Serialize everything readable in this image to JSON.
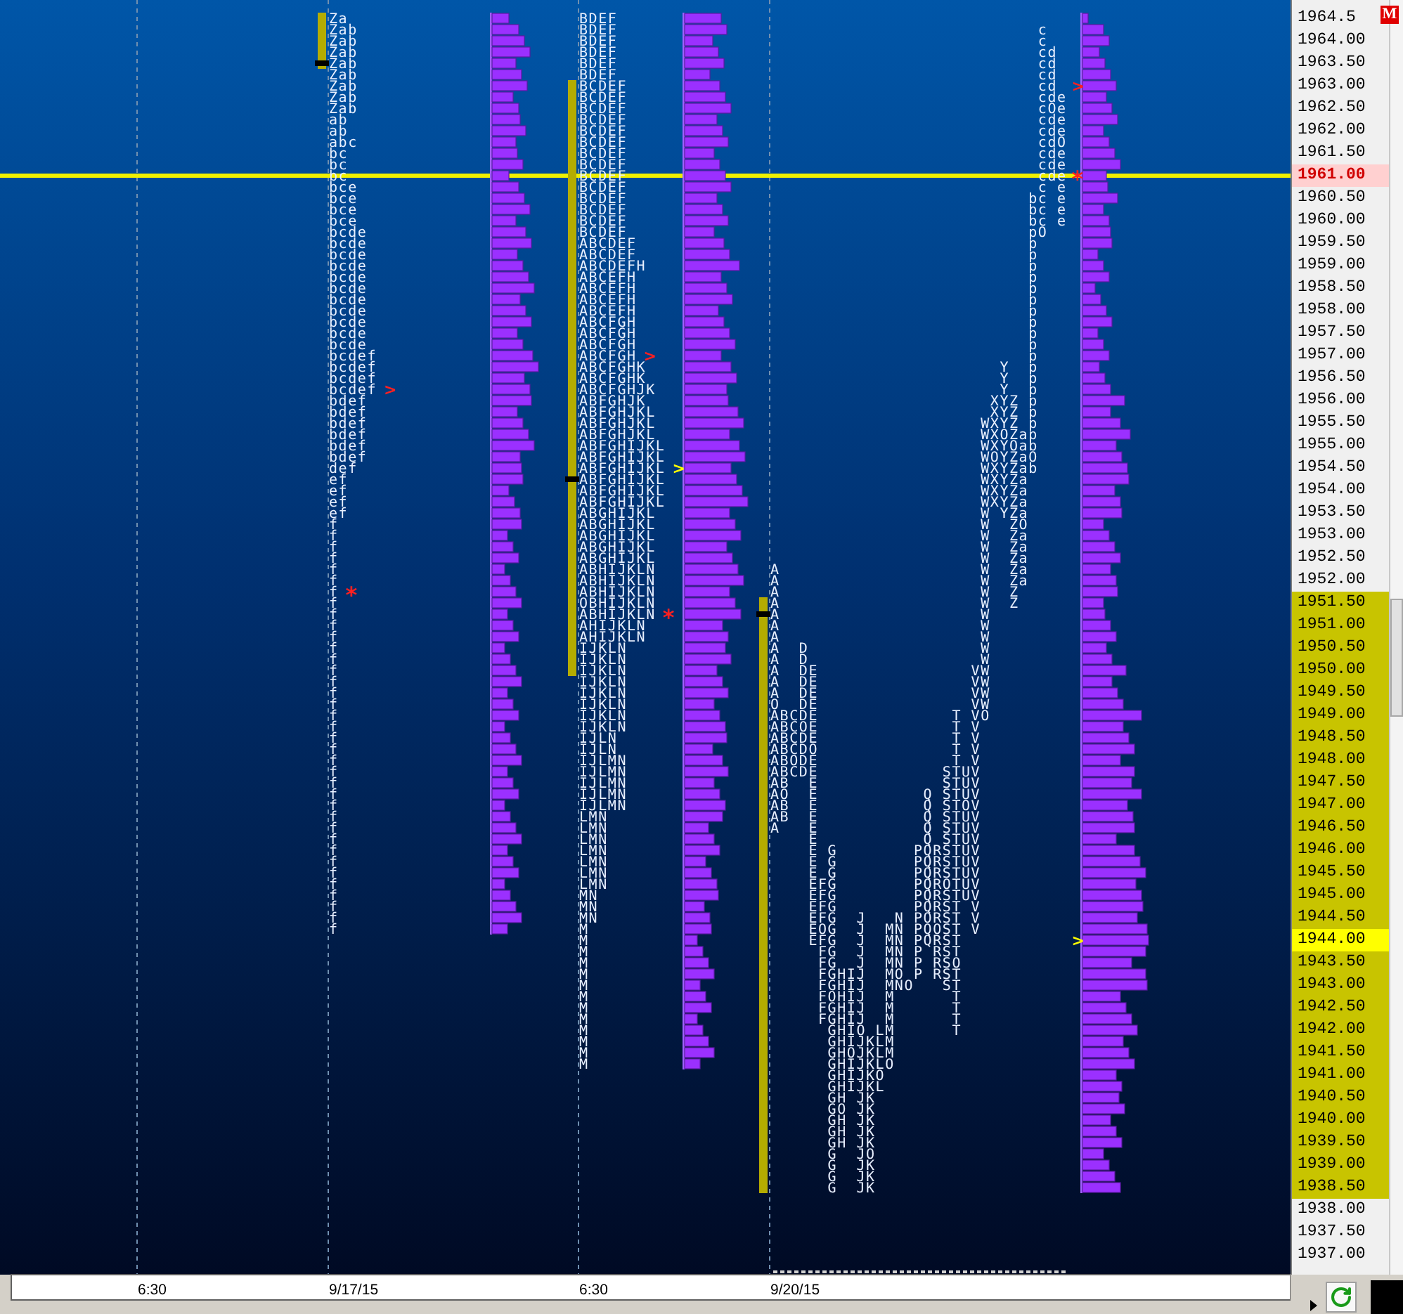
{
  "badge": "M",
  "time_labels": [
    "6:30",
    "9/17/15",
    "6:30",
    "9/20/15"
  ],
  "profiles": [
    {
      "kind": "compact",
      "rows": [
        {
          "tpo": "Za",
          "value_area": true,
          "poc": false
        },
        {
          "tpo": "Zab",
          "value_area": true,
          "poc": false
        },
        {
          "tpo": "Zab",
          "value_area": true,
          "poc": false
        },
        {
          "tpo": "Zab",
          "value_area": true,
          "poc": false
        },
        {
          "tpo": "Zab",
          "value_area": true,
          "poc": true
        },
        {
          "tpo": "Zab",
          "value_area": false,
          "poc": false
        },
        {
          "tpo": "Zab",
          "value_area": false,
          "poc": false
        },
        {
          "tpo": "Zab",
          "value_area": false,
          "poc": false
        },
        {
          "tpo": "Zab",
          "value_area": false,
          "poc": false
        },
        {
          "tpo": "ab",
          "value_area": false,
          "poc": false
        },
        {
          "tpo": "ab",
          "value_area": false,
          "poc": false
        },
        {
          "tpo": "abc",
          "value_area": false,
          "poc": false
        },
        {
          "tpo": "bc",
          "value_area": false,
          "poc": false
        },
        {
          "tpo": "bc",
          "value_area": false,
          "poc": false
        },
        {
          "tpo": "bc",
          "value_area": false,
          "poc": false
        },
        {
          "tpo": "bce",
          "value_area": false,
          "poc": false
        },
        {
          "tpo": "bce",
          "value_area": false,
          "poc": false
        },
        {
          "tpo": "bce",
          "value_area": false,
          "poc": false
        },
        {
          "tpo": "bce",
          "value_area": false,
          "poc": false
        },
        {
          "tpo": "bcde",
          "value_area": false,
          "poc": false
        },
        {
          "tpo": "bcde",
          "value_area": false,
          "poc": false
        },
        {
          "tpo": "bcde",
          "value_area": false,
          "poc": false
        },
        {
          "tpo": "bcde",
          "value_area": false,
          "poc": false
        },
        {
          "tpo": "bcde",
          "value_area": false,
          "poc": false
        },
        {
          "tpo": "bcde",
          "value_area": false,
          "poc": false
        },
        {
          "tpo": "bcde",
          "value_area": false,
          "poc": false
        },
        {
          "tpo": "bcde",
          "value_area": false,
          "poc": false
        },
        {
          "tpo": "bcde",
          "value_area": false,
          "poc": false
        },
        {
          "tpo": "bcde",
          "value_area": false,
          "poc": false
        },
        {
          "tpo": "bcde",
          "value_area": false,
          "poc": false
        },
        {
          "tpo": "bcdef",
          "value_area": false,
          "poc": false
        },
        {
          "tpo": "bcdef",
          "value_area": false,
          "poc": false
        },
        {
          "tpo": "bcdef",
          "value_area": false,
          "poc": false
        },
        {
          "tpo": "bcdef",
          "value_area": false,
          "poc": false,
          "marker": {
            "kind": "arrow",
            "text": ">",
            "color": "#ff2020"
          }
        },
        {
          "tpo": "bdef",
          "value_area": false,
          "poc": false
        },
        {
          "tpo": "bdef",
          "value_area": false,
          "poc": false
        },
        {
          "tpo": "bdef",
          "value_area": false,
          "poc": false
        },
        {
          "tpo": "bdef",
          "value_area": false,
          "poc": false
        },
        {
          "tpo": "bdef",
          "value_area": false,
          "poc": false
        },
        {
          "tpo": "bdef",
          "value_area": false,
          "poc": false
        },
        {
          "tpo": "def",
          "value_area": false,
          "poc": false
        },
        {
          "tpo": "ef",
          "value_area": false,
          "poc": false
        },
        {
          "tpo": "ef",
          "value_area": false,
          "poc": false
        },
        {
          "tpo": "ef",
          "value_area": false,
          "poc": false
        },
        {
          "tpo": "ef",
          "value_area": false,
          "poc": false
        },
        {
          "tpo": "f",
          "value_area": false,
          "poc": false
        },
        {
          "tpo": "f",
          "value_area": false,
          "poc": false
        },
        {
          "tpo": "f",
          "value_area": false,
          "poc": false
        },
        {
          "tpo": "f",
          "value_area": false,
          "poc": false
        },
        {
          "tpo": "f",
          "value_area": false,
          "poc": false
        },
        {
          "tpo": "f",
          "value_area": false,
          "poc": false
        },
        {
          "tpo": "f",
          "value_area": false,
          "poc": false,
          "marker": {
            "kind": "star",
            "text": "*",
            "color": "#ff2020"
          }
        },
        {
          "tpo": "f",
          "value_area": false,
          "poc": false
        },
        {
          "tpo": "f",
          "value_area": false,
          "poc": false
        },
        {
          "tpo": "f",
          "value_area": false,
          "poc": false
        },
        {
          "tpo": "f",
          "value_area": false,
          "poc": false
        },
        {
          "tpo": "f",
          "value_area": false,
          "poc": false
        },
        {
          "tpo": "f",
          "value_area": false,
          "poc": false
        },
        {
          "tpo": "f",
          "value_area": false,
          "poc": false
        },
        {
          "tpo": "f",
          "value_area": false,
          "poc": false
        },
        {
          "tpo": "f",
          "value_area": false,
          "poc": false
        },
        {
          "tpo": "f",
          "value_area": false,
          "poc": false
        },
        {
          "tpo": "f",
          "value_area": false,
          "poc": false
        },
        {
          "tpo": "f",
          "value_area": false,
          "poc": false
        },
        {
          "tpo": "f",
          "value_area": false,
          "poc": false
        },
        {
          "tpo": "f",
          "value_area": false,
          "poc": false
        },
        {
          "tpo": "f",
          "value_area": false,
          "poc": false
        },
        {
          "tpo": "f",
          "value_area": false,
          "poc": false
        },
        {
          "tpo": "f",
          "value_area": false,
          "poc": false
        },
        {
          "tpo": "f",
          "value_area": false,
          "poc": false
        },
        {
          "tpo": "f",
          "value_area": false,
          "poc": false
        },
        {
          "tpo": "f",
          "value_area": false,
          "poc": false
        },
        {
          "tpo": "f",
          "value_area": false,
          "poc": false
        },
        {
          "tpo": "f",
          "value_area": false,
          "poc": false
        },
        {
          "tpo": "f",
          "value_area": false,
          "poc": false
        },
        {
          "tpo": "f",
          "value_area": false,
          "poc": false
        },
        {
          "tpo": "f",
          "value_area": false,
          "poc": false
        },
        {
          "tpo": "f",
          "value_area": false,
          "poc": false
        },
        {
          "tpo": "f",
          "value_area": false,
          "poc": false
        },
        {
          "tpo": "f",
          "value_area": false,
          "poc": false
        },
        {
          "tpo": "f",
          "value_area": false,
          "poc": false
        },
        {
          "tpo": "f",
          "value_area": false,
          "poc": false
        }
      ]
    },
    {
      "kind": "compact",
      "rows": [
        {
          "tpo": "BDEF",
          "value_area": false,
          "poc": false
        },
        {
          "tpo": "BDEF",
          "value_area": false,
          "poc": false
        },
        {
          "tpo": "BDEF",
          "value_area": false,
          "poc": false
        },
        {
          "tpo": "BDEF",
          "value_area": false,
          "poc": false
        },
        {
          "tpo": "BDEF",
          "value_area": false,
          "poc": false
        },
        {
          "tpo": "BDEF",
          "value_area": false,
          "poc": false
        },
        {
          "tpo": "BCDEF",
          "value_area": true,
          "poc": false
        },
        {
          "tpo": "BCDEF",
          "value_area": true,
          "poc": false
        },
        {
          "tpo": "BCDEF",
          "value_area": true,
          "poc": false
        },
        {
          "tpo": "BCDEF",
          "value_area": true,
          "poc": false
        },
        {
          "tpo": "BCDEF",
          "value_area": true,
          "poc": false
        },
        {
          "tpo": "BCDEF",
          "value_area": true,
          "poc": false
        },
        {
          "tpo": "BCDEF",
          "value_area": true,
          "poc": false
        },
        {
          "tpo": "BCDEF",
          "value_area": true,
          "poc": false
        },
        {
          "tpo": "BCDEF",
          "value_area": true,
          "poc": false
        },
        {
          "tpo": "BCDEF",
          "value_area": true,
          "poc": false
        },
        {
          "tpo": "BCDEF",
          "value_area": true,
          "poc": false
        },
        {
          "tpo": "BCDEF",
          "value_area": true,
          "poc": false
        },
        {
          "tpo": "BCDEF",
          "value_area": true,
          "poc": false
        },
        {
          "tpo": "BCDEF",
          "value_area": true,
          "poc": false
        },
        {
          "tpo": "ABCDEF",
          "value_area": true,
          "poc": false
        },
        {
          "tpo": "ABCDEF",
          "value_area": true,
          "poc": false
        },
        {
          "tpo": "ABCDEFH",
          "value_area": true,
          "poc": false
        },
        {
          "tpo": "ABCEFH",
          "value_area": true,
          "poc": false
        },
        {
          "tpo": "ABCEFH",
          "value_area": true,
          "poc": false
        },
        {
          "tpo": "ABCEFH",
          "value_area": true,
          "poc": false
        },
        {
          "tpo": "ABCEFH",
          "value_area": true,
          "poc": false
        },
        {
          "tpo": "ABCFGH",
          "value_area": true,
          "poc": false
        },
        {
          "tpo": "ABCFGH",
          "value_area": true,
          "poc": false
        },
        {
          "tpo": "ABCFGH",
          "value_area": true,
          "poc": false
        },
        {
          "tpo": "ABCFGH",
          "value_area": true,
          "poc": false,
          "marker": {
            "kind": "arrow",
            "text": ">",
            "color": "#ff2020"
          }
        },
        {
          "tpo": "ABCFGHK",
          "value_area": true,
          "poc": false
        },
        {
          "tpo": "ABCFGHK",
          "value_area": true,
          "poc": false
        },
        {
          "tpo": "ABCFGHJK",
          "value_area": true,
          "poc": false
        },
        {
          "tpo": "ABFGHJK",
          "value_area": true,
          "poc": false
        },
        {
          "tpo": "ABFGHJKL",
          "value_area": true,
          "poc": false
        },
        {
          "tpo": "ABFGHJKL",
          "value_area": true,
          "poc": false
        },
        {
          "tpo": "ABFGHJKL",
          "value_area": true,
          "poc": false
        },
        {
          "tpo": "ABFGHIJKL",
          "value_area": true,
          "poc": false
        },
        {
          "tpo": "ABFGHIJKL",
          "value_area": true,
          "poc": false
        },
        {
          "tpo": "ABFGHIJKL",
          "value_area": true,
          "poc": false,
          "marker": {
            "kind": "arrow",
            "text": ">",
            "color": "#ffff00"
          }
        },
        {
          "tpo": "ABFGHIJKL",
          "value_area": true,
          "poc": true
        },
        {
          "tpo": "ABFGHIJKL",
          "value_area": true,
          "poc": false
        },
        {
          "tpo": "ABFGHIJKL",
          "value_area": true,
          "poc": false
        },
        {
          "tpo": "ABGHIJKL",
          "value_area": true,
          "poc": false
        },
        {
          "tpo": "ABGHIJKL",
          "value_area": true,
          "poc": false
        },
        {
          "tpo": "ABGHIJKL",
          "value_area": true,
          "poc": false
        },
        {
          "tpo": "ABGHIJKL",
          "value_area": true,
          "poc": false
        },
        {
          "tpo": "ABGHIJKL",
          "value_area": true,
          "poc": false
        },
        {
          "tpo": "ABHIJKLN",
          "value_area": true,
          "poc": false
        },
        {
          "tpo": "ABHIJKLN",
          "value_area": true,
          "poc": false
        },
        {
          "tpo": "ABHIJKLN",
          "value_area": true,
          "poc": false
        },
        {
          "tpo": "OBHIJKLN",
          "value_area": true,
          "poc": false
        },
        {
          "tpo": "ABHIJKLN",
          "value_area": true,
          "poc": false,
          "marker": {
            "kind": "star",
            "text": "*",
            "color": "#ff2020"
          }
        },
        {
          "tpo": "AHIJKLN",
          "value_area": true,
          "poc": false
        },
        {
          "tpo": "AHIJKLN",
          "value_area": true,
          "poc": false
        },
        {
          "tpo": "IJKLN",
          "value_area": true,
          "poc": false
        },
        {
          "tpo": "IJKLN",
          "value_area": true,
          "poc": false
        },
        {
          "tpo": "IJKLN",
          "value_area": true,
          "poc": false
        },
        {
          "tpo": "IJKLN",
          "value_area": false,
          "poc": false
        },
        {
          "tpo": "IJKLN",
          "value_area": false,
          "poc": false
        },
        {
          "tpo": "IJKLN",
          "value_area": false,
          "poc": false
        },
        {
          "tpo": "IJKLN",
          "value_area": false,
          "poc": false
        },
        {
          "tpo": "IJKLN",
          "value_area": false,
          "poc": false
        },
        {
          "tpo": "IJLN",
          "value_area": false,
          "poc": false
        },
        {
          "tpo": "IJLN",
          "value_area": false,
          "poc": false
        },
        {
          "tpo": "IJLMN",
          "value_area": false,
          "poc": false
        },
        {
          "tpo": "IJLMN",
          "value_area": false,
          "poc": false
        },
        {
          "tpo": "IJLMN",
          "value_area": false,
          "poc": false
        },
        {
          "tpo": "IJLMN",
          "value_area": false,
          "poc": false
        },
        {
          "tpo": "IJLMN",
          "value_area": false,
          "poc": false
        },
        {
          "tpo": "LMN",
          "value_area": false,
          "poc": false
        },
        {
          "tpo": "LMN",
          "value_area": false,
          "poc": false
        },
        {
          "tpo": "LMN",
          "value_area": false,
          "poc": false
        },
        {
          "tpo": "LMN",
          "value_area": false,
          "poc": false
        },
        {
          "tpo": "LMN",
          "value_area": false,
          "poc": false
        },
        {
          "tpo": "LMN",
          "value_area": false,
          "poc": false
        },
        {
          "tpo": "LMN",
          "value_area": false,
          "poc": false
        },
        {
          "tpo": "MN",
          "value_area": false,
          "poc": false
        },
        {
          "tpo": "MN",
          "value_area": false,
          "poc": false
        },
        {
          "tpo": "MN",
          "value_area": false,
          "poc": false
        },
        {
          "tpo": "M",
          "value_area": false,
          "poc": false
        },
        {
          "tpo": "M",
          "value_area": false,
          "poc": false
        },
        {
          "tpo": "M",
          "value_area": false,
          "poc": false
        },
        {
          "tpo": "M",
          "value_area": false,
          "poc": false
        },
        {
          "tpo": "M",
          "value_area": false,
          "poc": false
        },
        {
          "tpo": "M",
          "value_area": false,
          "poc": false
        },
        {
          "tpo": "M",
          "value_area": false,
          "poc": false
        },
        {
          "tpo": "M",
          "value_area": false,
          "poc": false
        },
        {
          "tpo": "M",
          "value_area": false,
          "poc": false
        },
        {
          "tpo": "M",
          "value_area": false,
          "poc": false
        },
        {
          "tpo": "M",
          "value_area": false,
          "poc": false
        },
        {
          "tpo": "M",
          "value_area": false,
          "poc": false
        },
        {
          "tpo": "M",
          "value_area": false,
          "poc": false
        }
      ]
    },
    {
      "kind": "split",
      "rows": [
        {
          "value_area": false,
          "poc": false
        },
        {
          "tpo": "                            c",
          "value_area": false,
          "poc": false
        },
        {
          "tpo": "                            c",
          "value_area": false,
          "poc": false
        },
        {
          "tpo": "                            cd",
          "value_area": false,
          "poc": false
        },
        {
          "tpo": "                            cd",
          "value_area": false,
          "poc": false
        },
        {
          "tpo": "                            cd",
          "value_area": false,
          "poc": false
        },
        {
          "tpo": "                            cd",
          "value_area": false,
          "poc": false,
          "marker": {
            "kind": "arrow",
            "text": ">",
            "color": "#ff2020"
          }
        },
        {
          "tpo": "                            cde",
          "value_area": false,
          "poc": false
        },
        {
          "tpo": "                            cOe",
          "value_area": false,
          "poc": false
        },
        {
          "tpo": "                            cde",
          "value_area": false,
          "poc": false
        },
        {
          "tpo": "                            cde",
          "value_area": false,
          "poc": false
        },
        {
          "tpo": "                            cdO",
          "value_area": false,
          "poc": false
        },
        {
          "tpo": "                            cde",
          "value_area": false,
          "poc": false
        },
        {
          "tpo": "                            cde",
          "value_area": false,
          "poc": false
        },
        {
          "tpo": "                            cde",
          "value_area": false,
          "poc": false,
          "marker": {
            "kind": "star",
            "text": "*",
            "color": "#ff2020"
          }
        },
        {
          "tpo": "                            c e",
          "value_area": false,
          "poc": false
        },
        {
          "tpo": "                           bc e",
          "value_area": false,
          "poc": false
        },
        {
          "tpo": "                           bc e",
          "value_area": false,
          "poc": false
        },
        {
          "tpo": "                           bc e",
          "value_area": false,
          "poc": false
        },
        {
          "tpo": "                           pO",
          "value_area": false,
          "poc": false
        },
        {
          "tpo": "                           p",
          "value_area": false,
          "poc": false
        },
        {
          "tpo": "                           p",
          "value_area": false,
          "poc": false
        },
        {
          "tpo": "                           p",
          "value_area": false,
          "poc": false
        },
        {
          "tpo": "                           p",
          "value_area": false,
          "poc": false
        },
        {
          "tpo": "                           p",
          "value_area": false,
          "poc": false
        },
        {
          "tpo": "                           p",
          "value_area": false,
          "poc": false
        },
        {
          "tpo": "                           p",
          "value_area": false,
          "poc": false
        },
        {
          "tpo": "                           p",
          "value_area": false,
          "poc": false
        },
        {
          "tpo": "                           p",
          "value_area": false,
          "poc": false
        },
        {
          "tpo": "                           p",
          "value_area": false,
          "poc": false
        },
        {
          "tpo": "                           p",
          "value_area": false,
          "poc": false
        },
        {
          "tpo": "                        Y  p",
          "value_area": false,
          "poc": false
        },
        {
          "tpo": "                        Y  p",
          "value_area": false,
          "poc": false
        },
        {
          "tpo": "                        Y  p",
          "value_area": false,
          "poc": false
        },
        {
          "tpo": "                       XYZ p",
          "value_area": false,
          "poc": false
        },
        {
          "tpo": "                       XYZ p",
          "value_area": false,
          "poc": false
        },
        {
          "tpo": "                      WXYZ p",
          "value_area": false,
          "poc": false
        },
        {
          "tpo": "                      WXOZap",
          "value_area": false,
          "poc": false
        },
        {
          "tpo": "                      WXYOab",
          "value_area": false,
          "poc": false
        },
        {
          "tpo": "                      WOYZaO",
          "value_area": false,
          "poc": false
        },
        {
          "tpo": "                      WXYZab",
          "value_area": false,
          "poc": false
        },
        {
          "tpo": "                      WXYZa",
          "value_area": false,
          "poc": false
        },
        {
          "tpo": "                      WXYZa",
          "value_area": false,
          "poc": false
        },
        {
          "tpo": "                      WXYZa",
          "value_area": false,
          "poc": false
        },
        {
          "tpo": "                      W YZa",
          "value_area": false,
          "poc": false
        },
        {
          "tpo": "                      W  ZO",
          "value_area": false,
          "poc": false
        },
        {
          "tpo": "                      W  Za",
          "value_area": false,
          "poc": false
        },
        {
          "tpo": "                      W  Za",
          "value_area": false,
          "poc": false
        },
        {
          "tpo": "                      W  Za",
          "value_area": false,
          "poc": false
        },
        {
          "tpo": "A                     W  Za",
          "value_area": false,
          "poc": false
        },
        {
          "tpo": "A                     W  Za",
          "value_area": false,
          "poc": false
        },
        {
          "tpo": "A                     W  Z",
          "value_area": false,
          "poc": false
        },
        {
          "tpo": "A                     W  Z",
          "value_area": true,
          "poc": false
        },
        {
          "tpo": "A                     W",
          "value_area": true,
          "poc": true
        },
        {
          "tpo": "A                     W",
          "value_area": true,
          "poc": false
        },
        {
          "tpo": "A                     W",
          "value_area": true,
          "poc": false
        },
        {
          "tpo": "A  D                  W",
          "value_area": true,
          "poc": false
        },
        {
          "tpo": "A  D                  W",
          "value_area": true,
          "poc": false
        },
        {
          "tpo": "A  DE                VW",
          "value_area": true,
          "poc": false
        },
        {
          "tpo": "A  DE                VW",
          "value_area": true,
          "poc": false
        },
        {
          "tpo": "A  DE                VW",
          "value_area": true,
          "poc": false
        },
        {
          "tpo": "O  DE                VW",
          "value_area": true,
          "poc": false
        },
        {
          "tpo": "ABCDE              T VO",
          "value_area": true,
          "poc": false
        },
        {
          "tpo": "ABCOE              T V",
          "value_area": true,
          "poc": false
        },
        {
          "tpo": "ABCDE              T V",
          "value_area": true,
          "poc": false
        },
        {
          "tpo": "ABCDO              T V",
          "value_area": true,
          "poc": false
        },
        {
          "tpo": "ABODE              T V",
          "value_area": true,
          "poc": false
        },
        {
          "tpo": "ABCDE             STUV",
          "value_area": true,
          "poc": false
        },
        {
          "tpo": "AB  E             STUV",
          "value_area": true,
          "poc": false
        },
        {
          "tpo": "AO  E           Q STUV",
          "value_area": true,
          "poc": false
        },
        {
          "tpo": "AB  E           Q STOV",
          "value_area": true,
          "poc": false
        },
        {
          "tpo": "AB  E           Q STUV",
          "value_area": true,
          "poc": false
        },
        {
          "tpo": "A   E           Q STUV",
          "value_area": true,
          "poc": false
        },
        {
          "tpo": "    E           Q STUV",
          "value_area": true,
          "poc": false
        },
        {
          "tpo": "    E G        PQRSTUV",
          "value_area": true,
          "poc": false
        },
        {
          "tpo": "    E G        PQRSTUV",
          "value_area": true,
          "poc": false
        },
        {
          "tpo": "    E G        PQRSTUV",
          "value_area": true,
          "poc": false
        },
        {
          "tpo": "    EFG        PQROTUV",
          "value_area": true,
          "poc": false
        },
        {
          "tpo": "    EFG        PQRSTUV",
          "value_area": true,
          "poc": false
        },
        {
          "tpo": "    EFG        PQRST V",
          "value_area": true,
          "poc": false
        },
        {
          "tpo": "    EFG  J   N PORST V",
          "value_area": true,
          "poc": false
        },
        {
          "tpo": "    EOG  J  MN PQOST V",
          "value_area": true,
          "poc": false
        },
        {
          "tpo": "    EFG  J  MN PQRST",
          "value_area": true,
          "poc": false,
          "marker": {
            "kind": "arrow",
            "text": ">",
            "color": "#ffff00"
          }
        },
        {
          "tpo": "     FG  J  MN P RST",
          "value_area": true,
          "poc": false
        },
        {
          "tpo": "     FG  J  MN P RSO",
          "value_area": true,
          "poc": false
        },
        {
          "tpo": "     FGHIJ  MO P RST",
          "value_area": true,
          "poc": false
        },
        {
          "tpo": "     FGHIJ  MNO   ST",
          "value_area": true,
          "poc": false
        },
        {
          "tpo": "     FOHIJ  M      T",
          "value_area": true,
          "poc": false
        },
        {
          "tpo": "     FGHIJ  M      T",
          "value_area": true,
          "poc": false
        },
        {
          "tpo": "     FGHIJ  M      T",
          "value_area": true,
          "poc": false
        },
        {
          "tpo": "      GHIO LM      T",
          "value_area": true,
          "poc": false
        },
        {
          "tpo": "      GHIJKLM",
          "value_area": true,
          "poc": false
        },
        {
          "tpo": "      GHOJKLM",
          "value_area": true,
          "poc": false
        },
        {
          "tpo": "      GHIJKLO",
          "value_area": true,
          "poc": false
        },
        {
          "tpo": "      GHIJKO",
          "value_area": true,
          "poc": false
        },
        {
          "tpo": "      GHIJKL",
          "value_area": true,
          "poc": false
        },
        {
          "tpo": "      GH JK",
          "value_area": true,
          "poc": false
        },
        {
          "tpo": "      GO JK",
          "value_area": true,
          "poc": false
        },
        {
          "tpo": "      GH JK",
          "value_area": true,
          "poc": false
        },
        {
          "tpo": "      GH JK",
          "value_area": true,
          "poc": false
        },
        {
          "tpo": "      GH JK",
          "value_area": true,
          "poc": false
        },
        {
          "tpo": "      G  JO",
          "value_area": true,
          "poc": false
        },
        {
          "tpo": "      G  JK",
          "value_area": true,
          "poc": false
        },
        {
          "tpo": "      G  JK",
          "value_area": true,
          "poc": false
        },
        {
          "tpo": "      G  JK",
          "value_area": true,
          "poc": false
        }
      ]
    }
  ],
  "price_labels": [
    {
      "text": "1964.5",
      "kind": "plain",
      "line": false
    },
    {
      "text": "1964.00",
      "kind": "plain",
      "line": false
    },
    {
      "text": "1963.50",
      "kind": "plain",
      "line": false
    },
    {
      "text": "1963.00",
      "kind": "plain",
      "line": false
    },
    {
      "text": "1962.50",
      "kind": "plain",
      "line": false
    },
    {
      "text": "1962.00",
      "kind": "plain",
      "line": false
    },
    {
      "text": "1961.50",
      "kind": "plain",
      "line": false
    },
    {
      "text": "1961.00",
      "kind": "last",
      "line": true
    },
    {
      "text": "1960.50",
      "kind": "plain",
      "line": false
    },
    {
      "text": "1960.00",
      "kind": "plain",
      "line": false
    },
    {
      "text": "1959.50",
      "kind": "plain",
      "line": false
    },
    {
      "text": "1959.00",
      "kind": "plain",
      "line": false
    },
    {
      "text": "1958.50",
      "kind": "plain",
      "line": false
    },
    {
      "text": "1958.00",
      "kind": "plain",
      "line": false
    },
    {
      "text": "1957.50",
      "kind": "plain",
      "line": false
    },
    {
      "text": "1957.00",
      "kind": "plain",
      "line": false
    },
    {
      "text": "1956.50",
      "kind": "plain",
      "line": false
    },
    {
      "text": "1956.00",
      "kind": "plain",
      "line": false
    },
    {
      "text": "1955.50",
      "kind": "plain",
      "line": false
    },
    {
      "text": "1955.00",
      "kind": "plain",
      "line": false
    },
    {
      "text": "1954.50",
      "kind": "plain",
      "line": false
    },
    {
      "text": "1954.00",
      "kind": "plain",
      "line": false
    },
    {
      "text": "1953.50",
      "kind": "plain",
      "line": false
    },
    {
      "text": "1953.00",
      "kind": "plain",
      "line": false
    },
    {
      "text": "1952.50",
      "kind": "plain",
      "line": false
    },
    {
      "text": "1952.00",
      "kind": "plain",
      "line": false
    },
    {
      "text": "1951.50",
      "kind": "range",
      "line": false
    },
    {
      "text": "1951.00",
      "kind": "range",
      "line": false
    },
    {
      "text": "1950.50",
      "kind": "range",
      "line": false
    },
    {
      "text": "1950.00",
      "kind": "range",
      "line": false
    },
    {
      "text": "1949.50",
      "kind": "range",
      "line": false
    },
    {
      "text": "1949.00",
      "kind": "range",
      "line": false
    },
    {
      "text": "1948.50",
      "kind": "range",
      "line": false
    },
    {
      "text": "1948.00",
      "kind": "range",
      "line": false
    },
    {
      "text": "1947.50",
      "kind": "range",
      "line": false
    },
    {
      "text": "1947.00",
      "kind": "range",
      "line": false
    },
    {
      "text": "1946.50",
      "kind": "range",
      "line": false
    },
    {
      "text": "1946.00",
      "kind": "range",
      "line": false
    },
    {
      "text": "1945.50",
      "kind": "range",
      "line": false
    },
    {
      "text": "1945.00",
      "kind": "range",
      "line": false
    },
    {
      "text": "1944.50",
      "kind": "range",
      "line": false
    },
    {
      "text": "1944.00",
      "kind": "current",
      "line": false
    },
    {
      "text": "1943.50",
      "kind": "range",
      "line": false
    },
    {
      "text": "1943.00",
      "kind": "range",
      "line": false
    },
    {
      "text": "1942.50",
      "kind": "range",
      "line": false
    },
    {
      "text": "1942.00",
      "kind": "range",
      "line": false
    },
    {
      "text": "1941.50",
      "kind": "range",
      "line": false
    },
    {
      "text": "1941.00",
      "kind": "range",
      "line": false
    },
    {
      "text": "1940.50",
      "kind": "range",
      "line": false
    },
    {
      "text": "1940.00",
      "kind": "range",
      "line": false
    },
    {
      "text": "1939.50",
      "kind": "range",
      "line": false
    },
    {
      "text": "1939.00",
      "kind": "range",
      "line": false
    },
    {
      "text": "1938.50",
      "kind": "range",
      "line": false
    },
    {
      "text": "1938.00",
      "kind": "plain",
      "line": false
    },
    {
      "text": "1937.50",
      "kind": "plain",
      "line": false
    },
    {
      "text": "1937.00",
      "kind": "plain",
      "line": false
    }
  ]
}
